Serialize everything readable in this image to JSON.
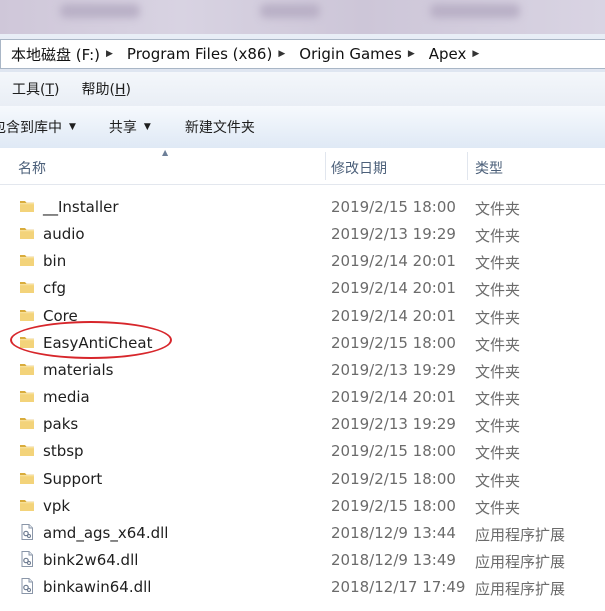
{
  "breadcrumb": [
    "本地磁盘 (F:)",
    "Program Files (x86)",
    "Origin Games",
    "Apex"
  ],
  "menu": [
    {
      "label": "工具(",
      "key": "T",
      "suffix": ")"
    },
    {
      "label": "帮助(",
      "key": "H",
      "suffix": ")"
    }
  ],
  "commands": {
    "include_library": "包含到库中",
    "share": "共享",
    "new_folder": "新建文件夹"
  },
  "columns": {
    "name": "名称",
    "date": "修改日期",
    "type": "类型"
  },
  "files": [
    {
      "name": "__Installer",
      "date": "2019/2/15 18:00",
      "type": "文件夹",
      "kind": "folder"
    },
    {
      "name": "audio",
      "date": "2019/2/13 19:29",
      "type": "文件夹",
      "kind": "folder"
    },
    {
      "name": "bin",
      "date": "2019/2/14 20:01",
      "type": "文件夹",
      "kind": "folder"
    },
    {
      "name": "cfg",
      "date": "2019/2/14 20:01",
      "type": "文件夹",
      "kind": "folder"
    },
    {
      "name": "Core",
      "date": "2019/2/14 20:01",
      "type": "文件夹",
      "kind": "folder"
    },
    {
      "name": "EasyAntiCheat",
      "date": "2019/2/15 18:00",
      "type": "文件夹",
      "kind": "folder",
      "highlighted": true
    },
    {
      "name": "materials",
      "date": "2019/2/13 19:29",
      "type": "文件夹",
      "kind": "folder"
    },
    {
      "name": "media",
      "date": "2019/2/14 20:01",
      "type": "文件夹",
      "kind": "folder"
    },
    {
      "name": "paks",
      "date": "2019/2/13 19:29",
      "type": "文件夹",
      "kind": "folder"
    },
    {
      "name": "stbsp",
      "date": "2019/2/15 18:00",
      "type": "文件夹",
      "kind": "folder"
    },
    {
      "name": "Support",
      "date": "2019/2/15 18:00",
      "type": "文件夹",
      "kind": "folder"
    },
    {
      "name": "vpk",
      "date": "2019/2/15 18:00",
      "type": "文件夹",
      "kind": "folder"
    },
    {
      "name": "amd_ags_x64.dll",
      "date": "2018/12/9 13:44",
      "type": "应用程序扩展",
      "kind": "dll"
    },
    {
      "name": "bink2w64.dll",
      "date": "2018/12/9 13:49",
      "type": "应用程序扩展",
      "kind": "dll"
    },
    {
      "name": "binkawin64.dll",
      "date": "2018/12/17 17:49",
      "type": "应用程序扩展",
      "kind": "dll"
    }
  ],
  "colors": {
    "highlight_ellipse": "#d7262b",
    "folder": "#e8c25a"
  }
}
